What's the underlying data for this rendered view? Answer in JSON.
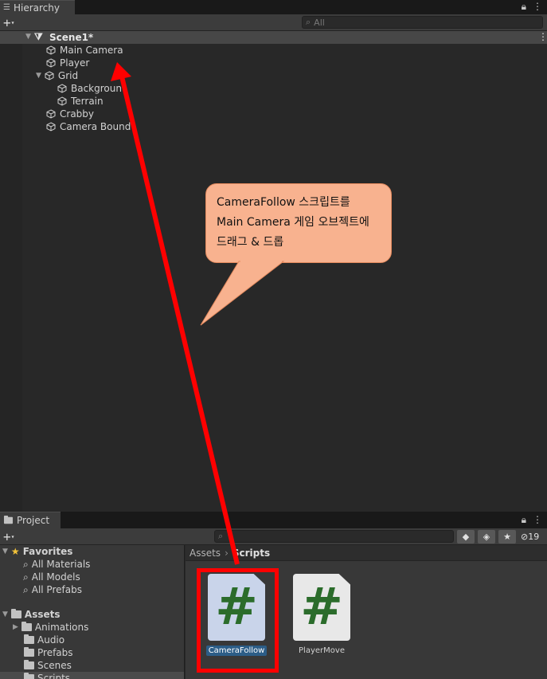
{
  "hierarchy": {
    "tab_label": "Hierarchy",
    "search_placeholder": "All",
    "scene_name": "Scene1*",
    "items": [
      {
        "label": "Main Camera"
      },
      {
        "label": "Player"
      },
      {
        "label": "Grid"
      },
      {
        "label": "Backgroun"
      },
      {
        "label": "Terrain"
      },
      {
        "label": "Crabby"
      },
      {
        "label": "Camera Bound"
      }
    ]
  },
  "project": {
    "tab_label": "Project",
    "hidden_count": "19",
    "favorites": {
      "label": "Favorites",
      "items": [
        "All Materials",
        "All Models",
        "All Prefabs"
      ]
    },
    "assets": {
      "label": "Assets",
      "folders": [
        "Animations",
        "Audio",
        "Prefabs",
        "Scenes",
        "Scripts"
      ]
    },
    "breadcrumb": {
      "root": "Assets",
      "current": "Scripts"
    },
    "files": [
      {
        "name": "CameraFollow",
        "selected": true
      },
      {
        "name": "PlayerMove",
        "selected": false
      }
    ]
  },
  "annotation": {
    "line1": "CameraFollow 스크립트를",
    "line2": "Main Camera 게임 오브젝트에",
    "line3": "드래그 & 드롭",
    "color": "#ff0000",
    "callout_color": "#f8b28f"
  },
  "icons": {
    "hash": "#",
    "star": "★"
  }
}
